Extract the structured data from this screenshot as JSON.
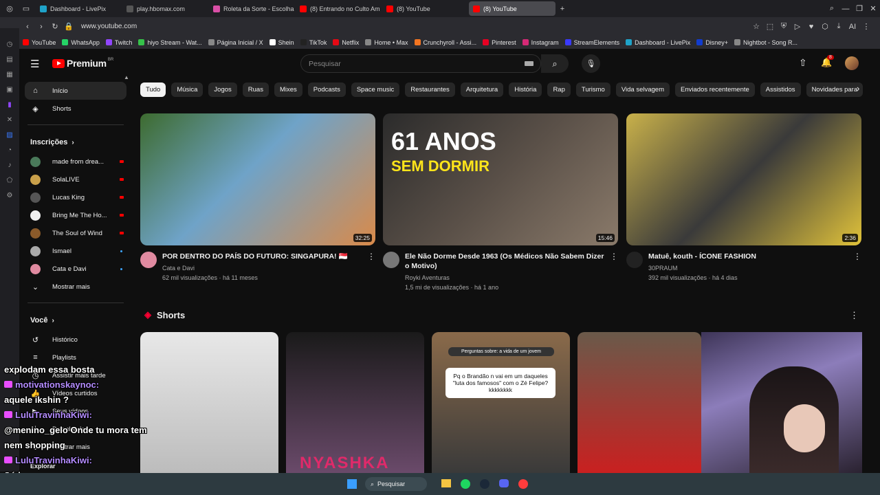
{
  "browser": {
    "tabs": [
      {
        "label": "Dashboard - LivePix",
        "color": "#1fa3c9"
      },
      {
        "label": "play.hbomax.com",
        "color": "#555"
      },
      {
        "label": "Roleta da Sorte - Escolha",
        "color": "#d94fa6"
      },
      {
        "label": "(8) Entrando no Culto Am",
        "color": "#ff0000"
      },
      {
        "label": "(8) YouTube",
        "color": "#ff0000"
      },
      {
        "label": "(8) YouTube",
        "color": "#ff0000"
      }
    ],
    "url": "www.youtube.com",
    "bookmarks": [
      {
        "label": "YouTube",
        "color": "#ff0000"
      },
      {
        "label": "WhatsApp",
        "color": "#25d366"
      },
      {
        "label": "Twitch",
        "color": "#9146ff"
      },
      {
        "label": "hiyo Stream - Wat...",
        "color": "#36c24a"
      },
      {
        "label": "Página Inicial / X",
        "color": "#888"
      },
      {
        "label": "Shein",
        "color": "#fff"
      },
      {
        "label": "TikTok",
        "color": "#222"
      },
      {
        "label": "Netflix",
        "color": "#e50914"
      },
      {
        "label": "Home • Max",
        "color": "#888"
      },
      {
        "label": "Crunchyroll - Assi...",
        "color": "#f47521"
      },
      {
        "label": "Pinterest",
        "color": "#e60023"
      },
      {
        "label": "Instagram",
        "color": "#d62976"
      },
      {
        "label": "StreamElements",
        "color": "#3a3aff"
      },
      {
        "label": "Dashboard - LivePix",
        "color": "#1fa3c9"
      },
      {
        "label": "Disney+",
        "color": "#113ccf"
      },
      {
        "label": "Nightbot - Song R...",
        "color": "#888"
      }
    ]
  },
  "header": {
    "logo_text": "Premium",
    "logo_badge": "BR",
    "search_placeholder": "Pesquisar",
    "notif_count": "8"
  },
  "chips": [
    "Tudo",
    "Música",
    "Jogos",
    "Ruas",
    "Mixes",
    "Podcasts",
    "Space music",
    "Restaurantes",
    "Arquitetura",
    "História",
    "Rap",
    "Turismo",
    "Vida selvagem",
    "Enviados recentemente",
    "Assistidos",
    "Novidades para"
  ],
  "sidebar": {
    "home": "Início",
    "shorts": "Shorts",
    "subs_title": "Inscrições",
    "subs": [
      {
        "label": "made from drea...",
        "color": "#4a7a5a",
        "status": "live"
      },
      {
        "label": "SolaLIVE",
        "color": "#c9a04a",
        "status": "live"
      },
      {
        "label": "Lucas King",
        "color": "#555",
        "status": "live"
      },
      {
        "label": "Bring Me The Ho...",
        "color": "#f0f0f0",
        "status": "live"
      },
      {
        "label": "The Soul of Wind",
        "color": "#8a5a2a",
        "status": "live"
      },
      {
        "label": "Ismael",
        "color": "#aaa",
        "status": "new"
      },
      {
        "label": "Cata e Davi",
        "color": "#e08aa0",
        "status": "new"
      }
    ],
    "show_more": "Mostrar mais",
    "you_title": "Você",
    "you_items": [
      "Histórico",
      "Playlists",
      "Assistir mais tarde",
      "Vídeos curtidos",
      "Seus vídeos",
      "Downloads",
      "Mostrar mais",
      "Explorar"
    ]
  },
  "videos": [
    {
      "title": "POR DENTRO DO PAÍS DO FUTURO: SINGAPURA! 🇸🇬",
      "channel": "Cata e Davi",
      "stats": "62 mil visualizações · há 11 meses",
      "duration": "32:25",
      "avatar": "#e08aa0",
      "thumb": "linear-gradient(135deg,#3d6b2f 0%,#6fa3c8 45%,#d98a4a 100%)"
    },
    {
      "title": "Ele Não Dorme Desde 1963 (Os Médicos Não Sabem Dizer o Motivo)",
      "channel": "Royki Aventuras",
      "stats": "1,5 mi de visualizações · há 1 ano",
      "duration": "15:46",
      "avatar": "#777",
      "thumb": "linear-gradient(135deg,#2b2b2b 0%,#5a5048 50%,#8a7a6a 100%)",
      "overlay1": "61 ANOS",
      "overlay2": "SEM DORMIR"
    },
    {
      "title": "Matuê, kouth - ÍCONE FASHION",
      "channel": "30PRAUM",
      "stats": "392 mil visualizações · há 4 dias",
      "duration": "2:36",
      "avatar": "#222",
      "thumb": "linear-gradient(135deg,#c9b14a 0%,#3a3a3a 50%,#e0c23a 100%)"
    }
  ],
  "shorts_title": "Shorts",
  "shorts": [
    {
      "color": "linear-gradient(180deg,#e8e8e8,#bcbcbc)"
    },
    {
      "color": "linear-gradient(180deg,#1a1a1a,#6a4a6a)",
      "text": "NYASHKA"
    },
    {
      "color": "linear-gradient(180deg,#8a6a4a,#3a3a3a)",
      "bubble_head": "Perguntas sobre: a vida de um jovem",
      "bubble": "Pq o Brandão n vai em um daqueles \"luta dos famosos\" com o Zé Felipe?kkkkkkkk"
    },
    {
      "color": "linear-gradient(180deg,#6a5a4a,#c92020)"
    }
  ],
  "chat": [
    {
      "user": "",
      "msg": "explodam essa bosta"
    },
    {
      "user": "motivationskaynoc",
      "msg": "aquele ikshin ?"
    },
    {
      "user": "LuluTravinhaKiwi",
      "msg": "@menino_gelo Onde tu mora tem nem shopping"
    },
    {
      "user": "LuluTravinhaKiwi",
      "msg": "Só barro"
    }
  ],
  "taskbar": {
    "search": "Pesquisar"
  }
}
